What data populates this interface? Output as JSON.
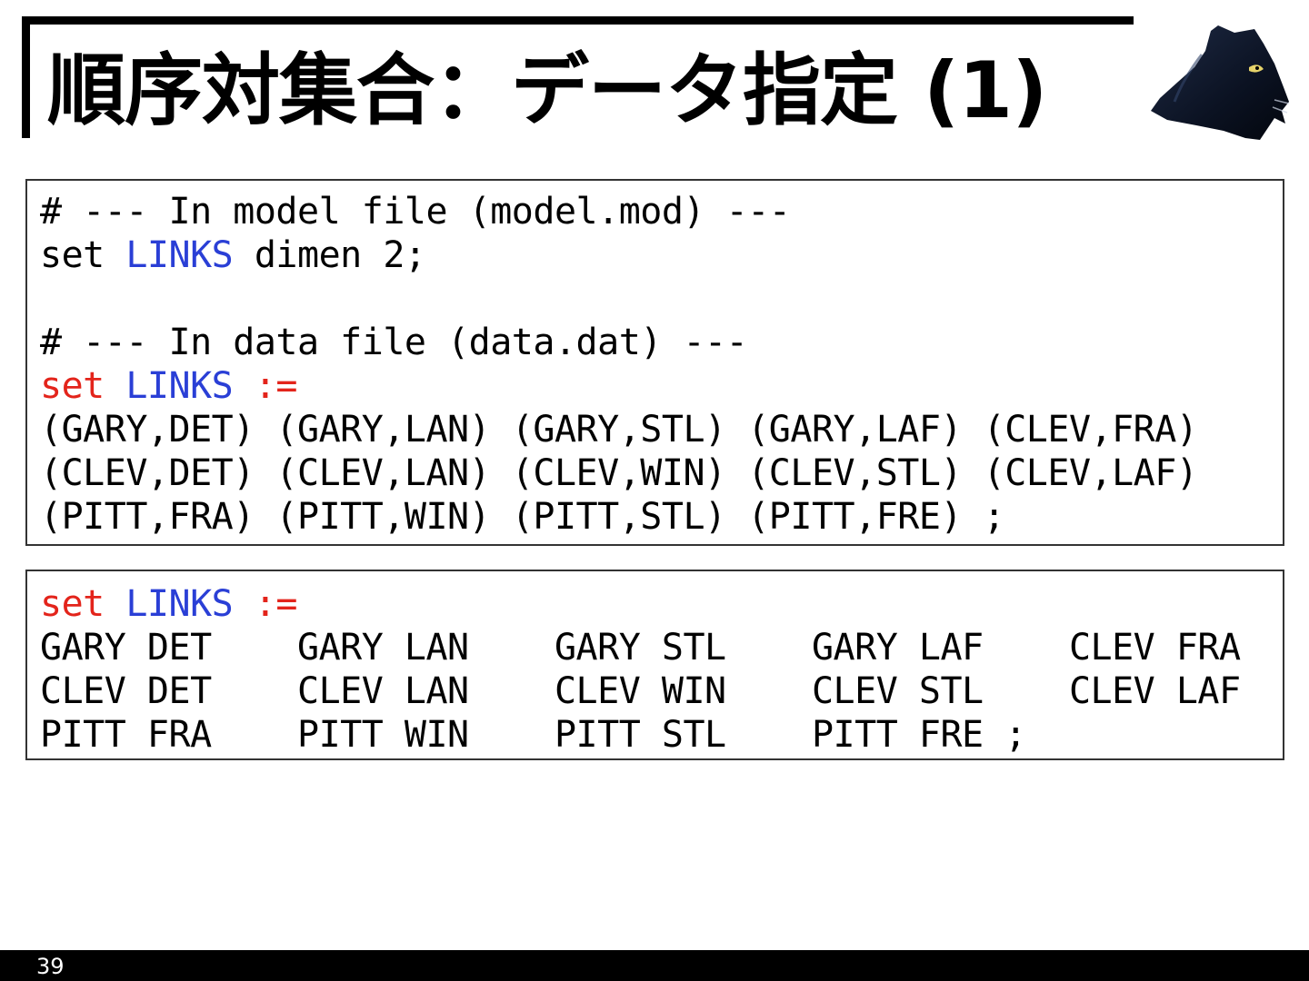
{
  "slide": {
    "title": "順序対集合：データ指定 (1)",
    "page_number": "39"
  },
  "colors": {
    "keyword_red": "#e3241b",
    "keyword_blue": "#2a3fd6",
    "text": "#000000"
  },
  "model_block": {
    "comment": "# --- In model file (model.mod) ---",
    "decl_set": "set ",
    "decl_name": "LINKS",
    "decl_rest": " dimen 2;"
  },
  "data_block": {
    "comment": "# --- In data file (data.dat) ---",
    "set_kw": "set",
    "space": " ",
    "set_name": "LINKS",
    "assign": " :=",
    "rows": [
      "(GARY,DET) (GARY,LAN) (GARY,STL) (GARY,LAF) (CLEV,FRA)",
      "(CLEV,DET) (CLEV,LAN) (CLEV,WIN) (CLEV,STL) (CLEV,LAF)",
      "(PITT,FRA) (PITT,WIN) (PITT,STL) (PITT,FRE) ;"
    ]
  },
  "alt_block": {
    "set_kw": "set",
    "space": " ",
    "set_name": "LINKS",
    "assign": " :=",
    "rows": [
      "GARY DET    GARY LAN    GARY STL    GARY LAF    CLEV FRA",
      "CLEV DET    CLEV LAN    CLEV WIN    CLEV STL    CLEV LAF",
      "PITT FRA    PITT WIN    PITT STL    PITT FRE ;"
    ]
  },
  "logo": {
    "icon": "black-cat-head-icon"
  }
}
